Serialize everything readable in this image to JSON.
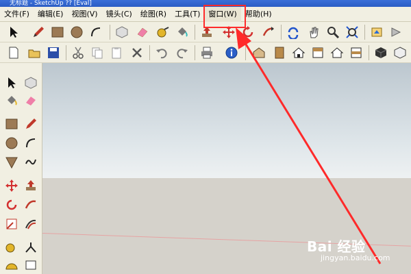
{
  "window": {
    "title": "无标题 - SketchUp ?? [Eval]"
  },
  "menu": {
    "items": [
      {
        "id": "file",
        "label": "文件(F)"
      },
      {
        "id": "edit",
        "label": "编辑(E)"
      },
      {
        "id": "view",
        "label": "视图(V)"
      },
      {
        "id": "camera",
        "label": "镜头(C)"
      },
      {
        "id": "draw",
        "label": "绘图(R)"
      },
      {
        "id": "tools",
        "label": "工具(T)"
      },
      {
        "id": "window",
        "label": "窗口(W)"
      },
      {
        "id": "help",
        "label": "帮助(H)"
      }
    ]
  },
  "annotation": {
    "highlight_target": "窗口(W)",
    "color": "#ff2a2a"
  },
  "watermark": {
    "brand": "Bai 经验",
    "url": "jingyan.baidu.com"
  },
  "colors": {
    "toolbar_bg": "#f1efe2",
    "sky_top": "#bcc7cf",
    "ground": "#d5d2cb",
    "accent": "#ff2a2a"
  }
}
